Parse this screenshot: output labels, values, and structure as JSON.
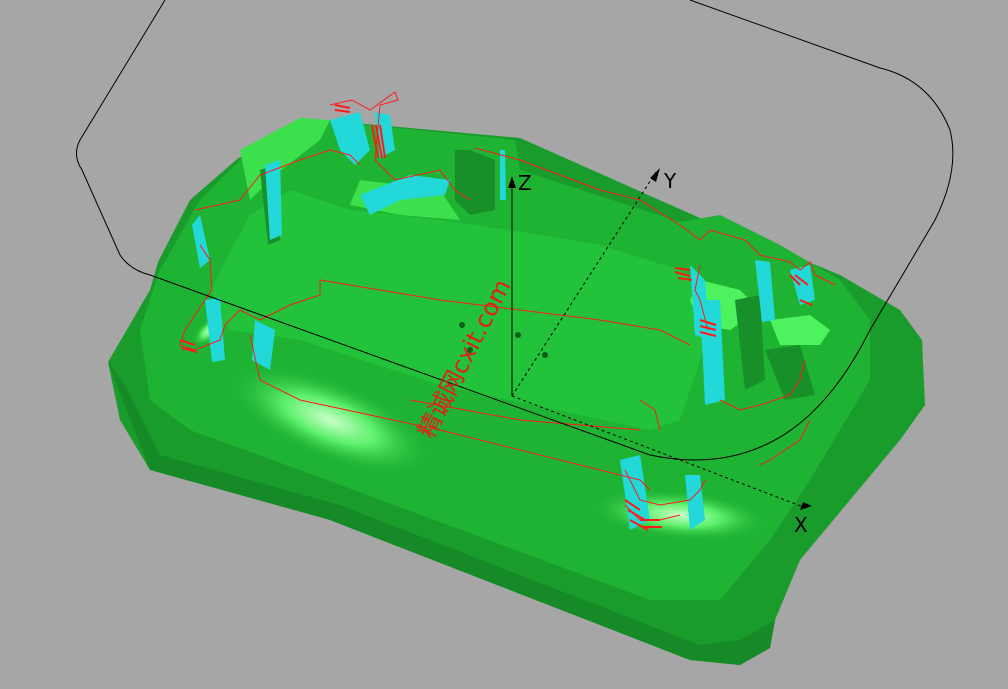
{
  "viewport": {
    "background_color": "#a6a6a6",
    "part_color": "#1fb334",
    "part_highlight_color": "#3ce04c",
    "toolpath_color": "#ff1a1a",
    "undercut_color": "#22d8d8",
    "boundary_color": "#000000"
  },
  "axes": {
    "x_label": "X",
    "y_label": "Y",
    "z_label": "Z"
  },
  "watermark": {
    "text": "精诚网cxit.com"
  }
}
